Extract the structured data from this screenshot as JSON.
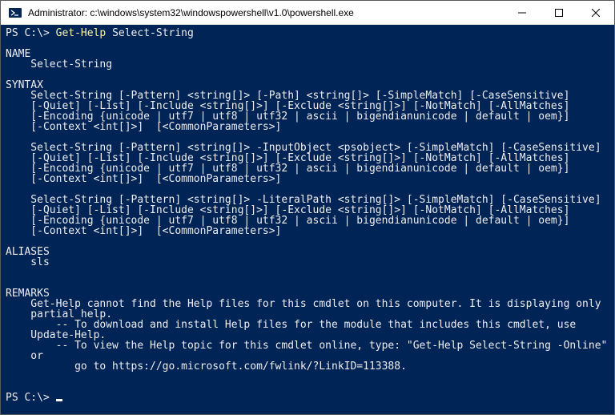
{
  "title": "Administrator: c:\\windows\\system32\\windowspowershell\\v1.0\\powershell.exe",
  "prompt": "PS C:\\>",
  "cmd_action": "Get-Help",
  "cmd_arg": "Select-String",
  "name_header": "NAME",
  "name_value": "    Select-String",
  "syntax_header": "SYNTAX",
  "syntax1_l1": "    Select-String [-Pattern] <string[]> [-Path] <string[]> [-SimpleMatch] [-CaseSensitive]",
  "syntax1_l2": "    [-Quiet] [-List] [-Include <string[]>] [-Exclude <string[]>] [-NotMatch] [-AllMatches]",
  "syntax1_l3": "    [-Encoding {unicode | utf7 | utf8 | utf32 | ascii | bigendianunicode | default | oem}]",
  "syntax1_l4": "    [-Context <int[]>]  [<CommonParameters>]",
  "syntax2_l1": "    Select-String [-Pattern] <string[]> -InputObject <psobject> [-SimpleMatch] [-CaseSensitive]",
  "syntax2_l2": "    [-Quiet] [-List] [-Include <string[]>] [-Exclude <string[]>] [-NotMatch] [-AllMatches]",
  "syntax2_l3": "    [-Encoding {unicode | utf7 | utf8 | utf32 | ascii | bigendianunicode | default | oem}]",
  "syntax2_l4": "    [-Context <int[]>]  [<CommonParameters>]",
  "syntax3_l1": "    Select-String [-Pattern] <string[]> -LiteralPath <string[]> [-SimpleMatch] [-CaseSensitive]",
  "syntax3_l2": "    [-Quiet] [-List] [-Include <string[]>] [-Exclude <string[]>] [-NotMatch] [-AllMatches]",
  "syntax3_l3": "    [-Encoding {unicode | utf7 | utf8 | utf32 | ascii | bigendianunicode | default | oem}]",
  "syntax3_l4": "    [-Context <int[]>]  [<CommonParameters>]",
  "aliases_header": "ALIASES",
  "aliases_value": "    sls",
  "remarks_header": "REMARKS",
  "remarks_l1": "    Get-Help cannot find the Help files for this cmdlet on this computer. It is displaying only",
  "remarks_l2": "    partial help.",
  "remarks_l3": "        -- To download and install Help files for the module that includes this cmdlet, use",
  "remarks_l4": "    Update-Help.",
  "remarks_l5": "        -- To view the Help topic for this cmdlet online, type: \"Get-Help Select-String -Online\"",
  "remarks_l6": "    or",
  "remarks_l7": "           go to https://go.microsoft.com/fwlink/?LinkID=113388."
}
